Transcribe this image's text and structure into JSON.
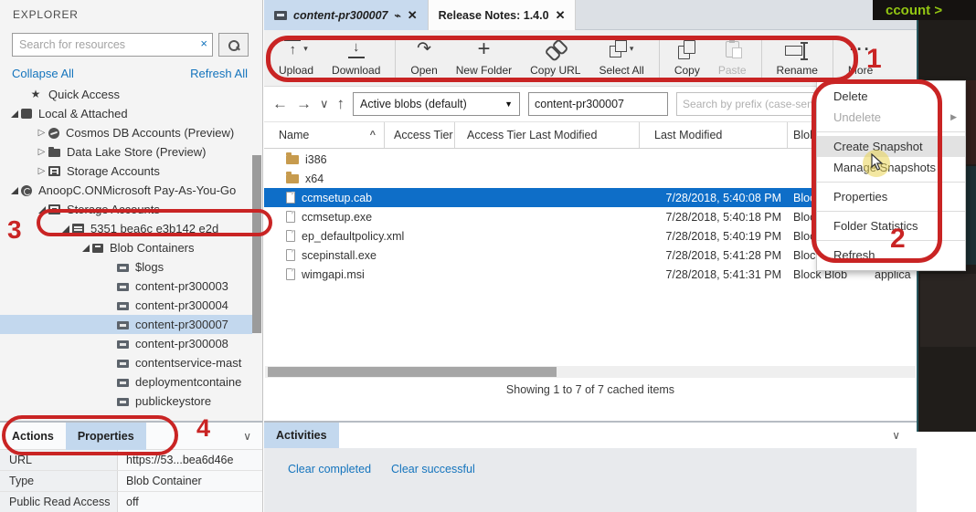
{
  "explorer": {
    "title": "EXPLORER",
    "search_placeholder": "Search for resources",
    "collapse_all": "Collapse All",
    "refresh_all": "Refresh All",
    "tree": [
      {
        "label": "Quick Access"
      },
      {
        "label": "Local & Attached"
      },
      {
        "label": "Cosmos DB Accounts (Preview)"
      },
      {
        "label": "Data Lake Store (Preview)"
      },
      {
        "label": "Storage Accounts"
      },
      {
        "label": "AnoopC.ONMicrosoft Pay-As-You-Go"
      },
      {
        "label": "Storage Accounts"
      },
      {
        "label": "5351 bea6c e3b142 e2d"
      },
      {
        "label": "Blob Containers"
      },
      {
        "label": "$logs"
      },
      {
        "label": "content-pr300003"
      },
      {
        "label": "content-pr300004"
      },
      {
        "label": "content-pr300007"
      },
      {
        "label": "content-pr300008"
      },
      {
        "label": "contentservice-mast"
      },
      {
        "label": "deploymentcontaine"
      },
      {
        "label": "publickeystore"
      }
    ]
  },
  "tabs": [
    {
      "label": "content-pr300007"
    },
    {
      "label": "Release Notes: 1.4.0"
    }
  ],
  "toolbar": {
    "buttons": [
      {
        "label": "Upload"
      },
      {
        "label": "Download"
      },
      {
        "label": "Open"
      },
      {
        "label": "New Folder"
      },
      {
        "label": "Copy URL"
      },
      {
        "label": "Select All"
      },
      {
        "label": "Copy"
      },
      {
        "label": "Paste"
      },
      {
        "label": "Rename"
      },
      {
        "label": "More"
      }
    ]
  },
  "nav": {
    "view_dropdown": "Active blobs (default)",
    "path_value": "content-pr300007",
    "prefix_placeholder": "Search by prefix (case-sensiti"
  },
  "table": {
    "columns": [
      "Name",
      "Access Tier",
      "Access Tier Last Modified",
      "Last Modified",
      "Blob Type"
    ],
    "rows": [
      {
        "name": "i386",
        "last_modified": "",
        "blob_type": "",
        "content_type": ""
      },
      {
        "name": "x64",
        "last_modified": "",
        "blob_type": "",
        "content_type": ""
      },
      {
        "name": "ccmsetup.cab",
        "last_modified": "7/28/2018, 5:40:08 PM",
        "blob_type": "Block Blob",
        "content_type": ""
      },
      {
        "name": "ccmsetup.exe",
        "last_modified": "7/28/2018, 5:40:18 PM",
        "blob_type": "Block Blob",
        "content_type": ""
      },
      {
        "name": "ep_defaultpolicy.xml",
        "last_modified": "7/28/2018, 5:40:19 PM",
        "blob_type": "Block Blob",
        "content_type": ""
      },
      {
        "name": "scepinstall.exe",
        "last_modified": "7/28/2018, 5:41:28 PM",
        "blob_type": "Block Blob",
        "content_type": ""
      },
      {
        "name": "wimgapi.msi",
        "last_modified": "7/28/2018, 5:41:31 PM",
        "blob_type": "Block Blob",
        "content_type": "applica"
      }
    ],
    "status": "Showing 1 to 7 of 7 cached items"
  },
  "context_menu": {
    "items": [
      {
        "label": "Delete"
      },
      {
        "label": "Undelete"
      },
      {
        "label": "Create Snapshot"
      },
      {
        "label": "Manage Snapshots"
      },
      {
        "label": "Properties"
      },
      {
        "label": "Folder Statistics"
      },
      {
        "label": "Refresh"
      }
    ]
  },
  "bottom_left": {
    "tabs": [
      {
        "label": "Actions"
      },
      {
        "label": "Properties"
      }
    ],
    "properties": [
      {
        "label": "URL",
        "value": "https://53...bea6d46e"
      },
      {
        "label": "Type",
        "value": "Blob Container"
      },
      {
        "label": "Public Read Access",
        "value": "off"
      }
    ]
  },
  "activities": {
    "tab": "Activities",
    "links": [
      {
        "label": "Clear completed"
      },
      {
        "label": "Clear successful"
      }
    ]
  },
  "overlay": {
    "video_text": "ccount >"
  },
  "annotations": {
    "n1": "1",
    "n2": "2",
    "n3": "3",
    "n4": "4",
    "color": "#c92424"
  }
}
